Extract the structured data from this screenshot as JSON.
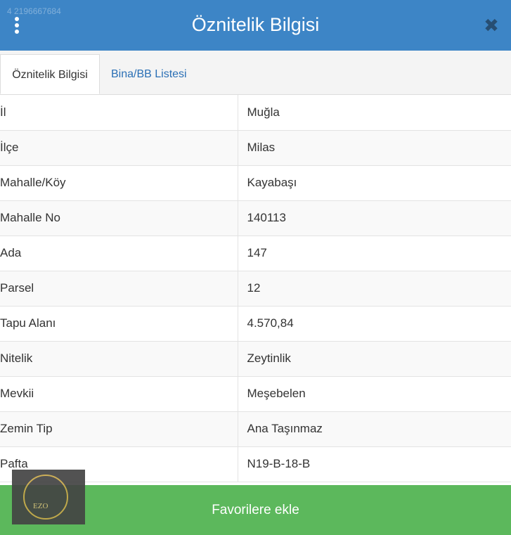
{
  "header": {
    "title": "Öznitelik Bilgisi",
    "watermark": "4 2196667684",
    "menu_icon": "vertical-dots-icon",
    "close_icon": "close-icon",
    "close_glyph": "✖"
  },
  "tabs": [
    {
      "label": "Öznitelik Bilgisi",
      "active": true
    },
    {
      "label": "Bina/BB Listesi",
      "active": false
    }
  ],
  "attributes": [
    {
      "key": "İl",
      "value": "Muğla"
    },
    {
      "key": "İlçe",
      "value": "Milas"
    },
    {
      "key": "Mahalle/Köy",
      "value": "Kayabaşı"
    },
    {
      "key": "Mahalle No",
      "value": "140113"
    },
    {
      "key": "Ada",
      "value": "147"
    },
    {
      "key": "Parsel",
      "value": "12"
    },
    {
      "key": "Tapu Alanı",
      "value": "4.570,84"
    },
    {
      "key": "Nitelik",
      "value": "Zeytinlik"
    },
    {
      "key": "Mevkii",
      "value": "Meşebelen"
    },
    {
      "key": "Zemin Tip",
      "value": "Ana Taşınmaz"
    },
    {
      "key": "Pafta",
      "value": "N19-B-18-B"
    }
  ],
  "footer": {
    "button_label": "Favorilere ekle"
  },
  "logo": {
    "text": "EZO"
  },
  "colors": {
    "header": "#3d85c6",
    "footer": "#5cb85c",
    "tab_link": "#2a6fb5"
  }
}
